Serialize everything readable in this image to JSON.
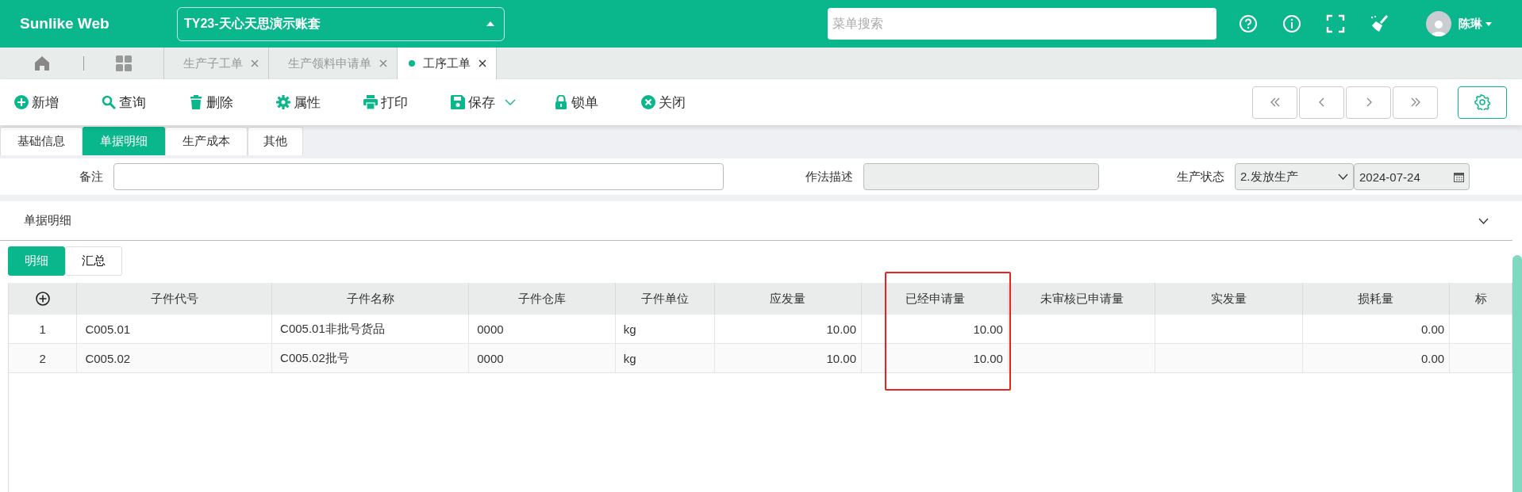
{
  "app": {
    "logo": "Sunlike Web",
    "account": "TY23-天心天思演示账套",
    "search": {
      "placeholder": "菜单搜索"
    },
    "user": "陈琳"
  },
  "page_tabs": [
    {
      "label": "生产子工单",
      "selected": false
    },
    {
      "label": "生产领料申请单",
      "selected": false
    },
    {
      "label": "工序工单",
      "selected": true
    }
  ],
  "toolbar": [
    {
      "kind": "add",
      "label": "新增",
      "has_menu": false
    },
    {
      "kind": "search",
      "label": "查询",
      "has_menu": false
    },
    {
      "kind": "delete",
      "label": "删除",
      "has_menu": false
    },
    {
      "kind": "settings",
      "label": "属性",
      "has_menu": false
    },
    {
      "kind": "print",
      "label": "打印",
      "has_menu": false
    },
    {
      "kind": "save",
      "label": "保存",
      "has_menu": true
    },
    {
      "kind": "lock",
      "label": "锁单",
      "has_menu": false
    },
    {
      "kind": "close",
      "label": "关闭",
      "has_menu": false
    }
  ],
  "form_tabs": [
    {
      "label": "基础信息",
      "selected": false
    },
    {
      "label": "单据明细",
      "selected": true
    },
    {
      "label": "生产成本",
      "selected": false
    },
    {
      "label": "其他",
      "selected": false
    }
  ],
  "form_fields": [
    {
      "kind": "text",
      "label": "备注",
      "disabled": false
    },
    {
      "kind": "text",
      "label": "作法描述",
      "disabled": true
    },
    {
      "kind": "select",
      "label": "生产状态",
      "value": "2.发放生产"
    },
    {
      "kind": "date",
      "value": "2024-07-24"
    }
  ],
  "section": {
    "title": "单据明细",
    "expanded": true
  },
  "detail_tabs": [
    {
      "label": "明细",
      "selected": true
    },
    {
      "label": "汇总",
      "selected": false
    }
  ],
  "table": {
    "columns": [
      {
        "label": "子件代号",
        "kind": "text",
        "highlighted": false
      },
      {
        "label": "子件名称",
        "kind": "text",
        "highlighted": false
      },
      {
        "label": "子件仓库",
        "kind": "text",
        "highlighted": false
      },
      {
        "label": "子件单位",
        "kind": "text",
        "highlighted": false
      },
      {
        "label": "应发量",
        "kind": "number",
        "highlighted": false
      },
      {
        "label": "已经申请量",
        "kind": "number",
        "highlighted": true
      },
      {
        "label": "未审核已申请量",
        "kind": "number",
        "highlighted": false
      },
      {
        "label": "实发量",
        "kind": "number",
        "highlighted": false
      },
      {
        "label": "损耗量",
        "kind": "number",
        "highlighted": false
      },
      {
        "label": "标",
        "kind": "number",
        "highlighted": false
      }
    ],
    "rows": [
      {
        "no": "1",
        "cells": [
          "C005.01",
          "C005.01非批号货品",
          "0000",
          "kg",
          "10.00",
          "10.00",
          null,
          null,
          "0.00",
          null
        ]
      },
      {
        "no": "2",
        "cells": [
          "C005.02",
          "C005.02批号",
          "0000",
          "kg",
          "10.00",
          "10.00",
          null,
          null,
          "0.00",
          null
        ]
      }
    ]
  }
}
